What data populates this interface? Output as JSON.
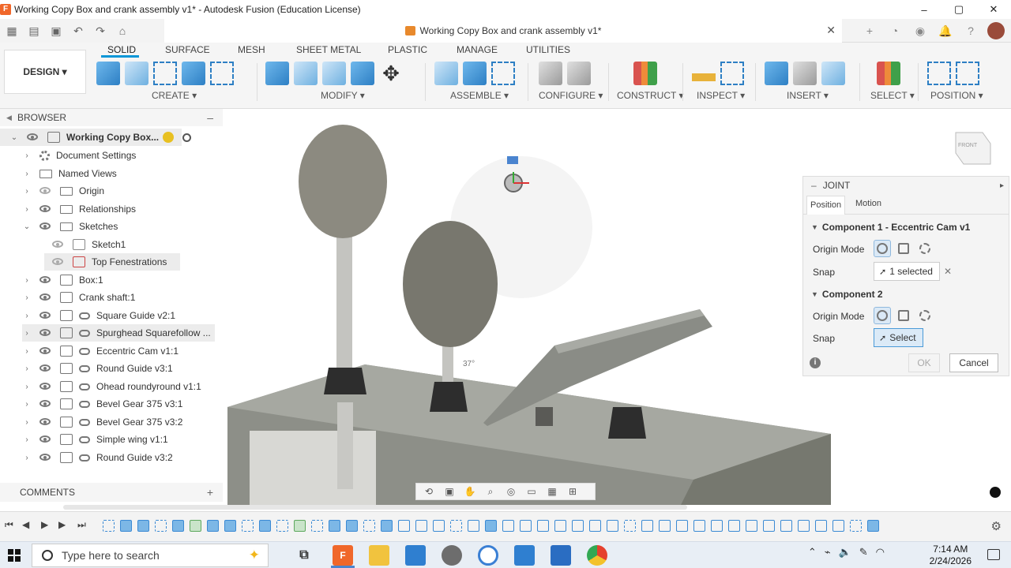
{
  "window": {
    "title": "Working Copy Box and crank assembly v1* - Autodesk Fusion (Education License)",
    "controls": [
      "–",
      "▢",
      "✕"
    ]
  },
  "doc_tab": {
    "title": "Working Copy Box and crank assembly v1*",
    "close": "✕"
  },
  "ribbon": {
    "workspace": "DESIGN ▾",
    "tabs": [
      "SOLID",
      "SURFACE",
      "MESH",
      "SHEET METAL",
      "PLASTIC",
      "MANAGE",
      "UTILITIES"
    ],
    "groups": [
      "CREATE ▾",
      "MODIFY ▾",
      "ASSEMBLE ▾",
      "CONFIGURE ▾",
      "CONSTRUCT ▾",
      "INSPECT ▾",
      "INSERT ▾",
      "SELECT ▾",
      "POSITION ▾"
    ]
  },
  "browser": {
    "title": "BROWSER",
    "root": "Working Copy Box...",
    "items": [
      "Document Settings",
      "Named Views",
      "Origin",
      "Relationships",
      "Sketches",
      "Sketch1",
      "Top Fenestrations",
      "Box:1",
      "Crank shaft:1",
      "Square Guide v2:1",
      "Spurghead Squarefollow ...",
      "Eccentric Cam v1:1",
      "Round  Guide v3:1",
      "Ohead roundyround v1:1",
      "Bevel Gear 375 v3:1",
      "Bevel Gear 375 v3:2",
      "Simple wing v1:1",
      "Round  Guide v3:2"
    ]
  },
  "comments": {
    "title": "COMMENTS",
    "add": "+"
  },
  "joint": {
    "title": "JOINT",
    "tabs": [
      "Position",
      "Motion"
    ],
    "component1": "Component 1 - Eccentric Cam v1",
    "component2": "Component 2",
    "origin_mode": "Origin Mode",
    "snap": "Snap",
    "snap1_value": "1 selected",
    "snap2_value": "Select",
    "ok": "OK",
    "cancel": "Cancel"
  },
  "viewport": {
    "angle_label": "37°",
    "viewcube": "FRONT"
  },
  "taskbar": {
    "search_placeholder": "Type here to search",
    "time": "7:14 AM",
    "date": "2/24/2026"
  },
  "colors": {
    "accent": "#0696d7",
    "fusion_orange": "#f0672a",
    "model_gray": "#8a8c86"
  }
}
